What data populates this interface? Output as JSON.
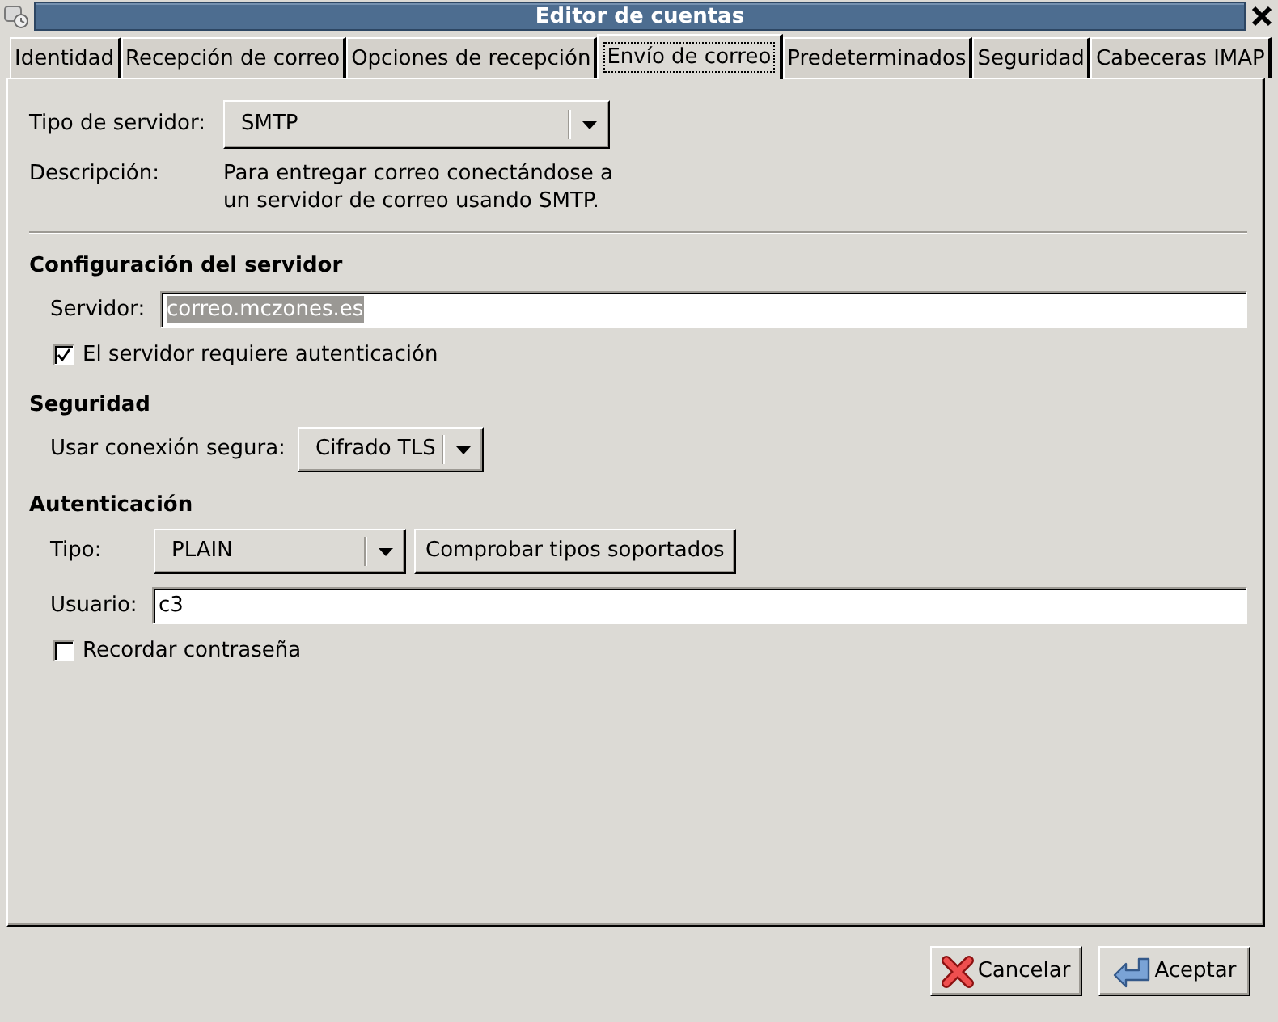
{
  "window": {
    "title": "Editor de cuentas"
  },
  "tabs": [
    {
      "label": "Identidad",
      "selected": false
    },
    {
      "label": "Recepción de correo",
      "selected": false
    },
    {
      "label": "Opciones de recepción",
      "selected": false
    },
    {
      "label": "Envío de correo",
      "selected": true
    },
    {
      "label": "Predeterminados",
      "selected": false
    },
    {
      "label": "Seguridad",
      "selected": false
    },
    {
      "label": "Cabeceras IMAP",
      "selected": false
    }
  ],
  "server_type": {
    "label": "Tipo de servidor:",
    "value": "SMTP"
  },
  "description": {
    "label": "Descripción:",
    "text": "Para entregar correo conectándose a un servidor de correo usando SMTP."
  },
  "server_config": {
    "title": "Configuración del servidor",
    "server": {
      "label": "Servidor:",
      "value": "correo.mczones.es",
      "text_selected": true
    },
    "requires_auth": {
      "label": "El servidor requiere autenticación",
      "checked": true
    }
  },
  "security": {
    "title": "Seguridad",
    "secure_connection": {
      "label": "Usar conexión segura:",
      "value": "Cifrado TLS"
    }
  },
  "authentication": {
    "title": "Autenticación",
    "type": {
      "label": "Tipo:",
      "value": "PLAIN"
    },
    "check_button": "Comprobar tipos soportados",
    "user": {
      "label": "Usuario:",
      "value": "c3"
    },
    "remember_password": {
      "label": "Recordar contraseña",
      "checked": false
    }
  },
  "buttons": [
    {
      "label": "Cancelar",
      "kind": "cancel"
    },
    {
      "label": "Aceptar",
      "kind": "ok"
    }
  ]
}
